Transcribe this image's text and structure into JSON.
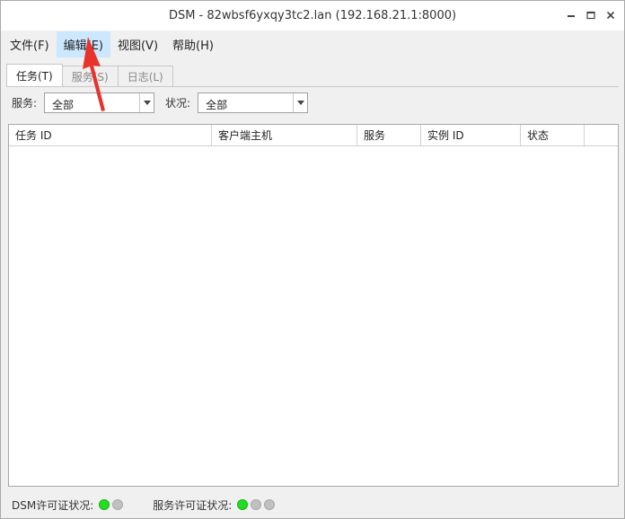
{
  "window": {
    "title": "DSM - 82wbsf6yxqy3tc2.lan (192.168.21.1:8000)",
    "controls": [
      {
        "name": "minimize-icon"
      },
      {
        "name": "maximize-icon"
      },
      {
        "name": "close-icon"
      }
    ]
  },
  "menu": {
    "items": [
      {
        "label": "文件(F)",
        "active": false
      },
      {
        "label": "编辑(E)",
        "active": true
      },
      {
        "label": "视图(V)",
        "active": false
      },
      {
        "label": "帮助(H)",
        "active": false
      }
    ]
  },
  "tabs": [
    {
      "label": "任务(T)",
      "active": true
    },
    {
      "label": "服务(S)",
      "active": false
    },
    {
      "label": "日志(L)",
      "active": false
    }
  ],
  "filters": {
    "service_label": "服务:",
    "service_value": "全部",
    "status_label": "状况:",
    "status_value": "全部"
  },
  "table": {
    "columns": [
      "任务 ID",
      "客户端主机",
      "服务",
      "实例 ID",
      "状态",
      ""
    ],
    "rows": []
  },
  "statusbar": {
    "dsm_label": "DSM许可证状况:",
    "dsm_dots": [
      "#22dd22",
      "#c0c0c0"
    ],
    "service_label": "服务许可证状况:",
    "service_dots": [
      "#22dd22",
      "#c0c0c0",
      "#c0c0c0"
    ]
  },
  "colors": {
    "active_menu_bg": "#cce8ff",
    "annotation_arrow": "#e8322c"
  }
}
